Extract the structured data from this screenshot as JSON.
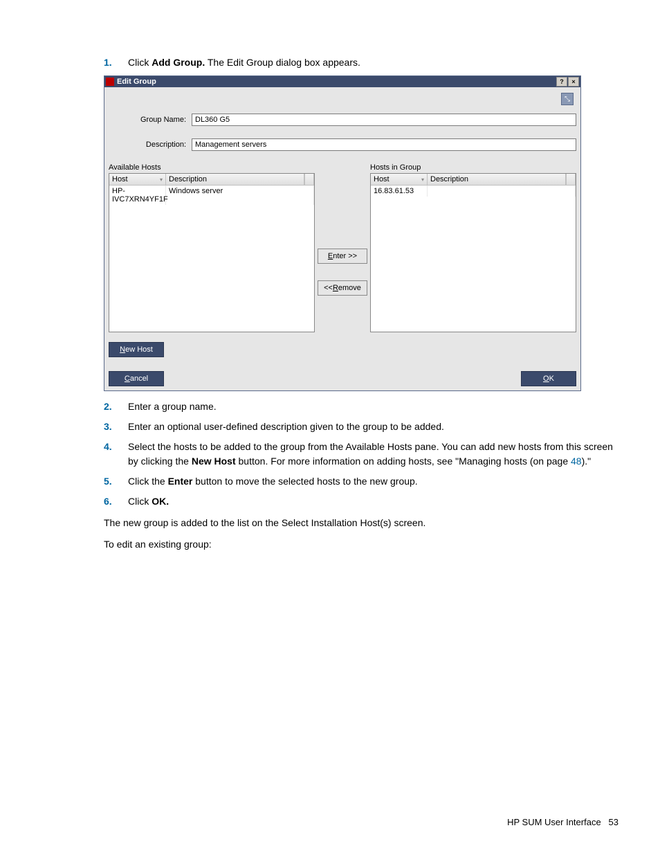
{
  "steps_top": [
    {
      "n": "1.",
      "pre": "Click ",
      "bold": "Add Group.",
      "post": " The Edit Group dialog box appears."
    }
  ],
  "dialog": {
    "title": "Edit Group",
    "help_glyph": "?",
    "close_glyph": "×",
    "corner_glyph": "⤡",
    "group_name_label": "Group Name:",
    "group_name_value": "DL360 G5",
    "description_label": "Description:",
    "description_value": "Management servers",
    "available_label": "Available Hosts",
    "in_group_label": "Hosts in Group",
    "col_host": "Host",
    "col_desc": "Description",
    "available_rows": [
      {
        "host": "HP-IVC7XRN4YF1F",
        "desc": "Windows server"
      }
    ],
    "group_rows": [
      {
        "host": "16.83.61.53",
        "desc": ""
      }
    ],
    "enter_btn": "Enter >>",
    "remove_btn": "<< Remove",
    "new_host_btn": "New Host",
    "cancel_btn": "Cancel",
    "ok_btn": "OK"
  },
  "steps_bottom": [
    {
      "n": "2.",
      "html": "Enter a group name."
    },
    {
      "n": "3.",
      "html": "Enter an optional user-defined description given to the group to be added."
    },
    {
      "n": "4.",
      "html": "Select the hosts to be added to the group from the Available Hosts pane. You can add new hosts from this screen by clicking the <b>New Host</b> button. For more information on adding hosts, see \"Managing hosts (on page <span class=\"link\">48</span>).\""
    },
    {
      "n": "5.",
      "html": "Click the <b>Enter</b> button to move the selected hosts to the new group."
    },
    {
      "n": "6.",
      "html": "Click <b>OK.</b>"
    }
  ],
  "para1": "The new group is added to the list on the Select Installation Host(s) screen.",
  "para2": "To edit an existing group:",
  "footer_text": "HP SUM User Interface",
  "footer_page": "53"
}
